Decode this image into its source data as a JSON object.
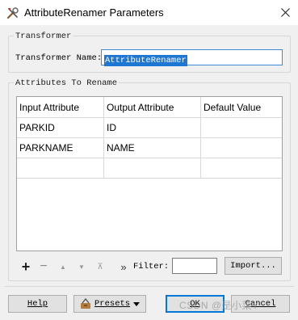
{
  "window": {
    "title": "AttributeRenamer Parameters"
  },
  "transformer_group": {
    "legend": "Transformer",
    "name_label": "Transformer Name:",
    "name_value": "AttributeRenamer"
  },
  "attributes_group": {
    "legend": "Attributes To Rename",
    "columns": [
      "Input Attribute",
      "Output Attribute",
      "Default Value"
    ],
    "rows": [
      {
        "input": "PARKID",
        "output": "ID",
        "default": ""
      },
      {
        "input": "PARKNAME",
        "output": "NAME",
        "default": ""
      }
    ]
  },
  "toolbar": {
    "add": "+",
    "remove": "−",
    "move_up": "▲",
    "move_down": "▼",
    "move_top": "⊼",
    "more": "»",
    "filter_label": "Filter:",
    "filter_value": "",
    "import_label": "Import..."
  },
  "buttons": {
    "help": "Help",
    "presets": "Presets",
    "ok": "OK",
    "cancel": "Cancel"
  },
  "watermark": "CSDN @是小菜Y"
}
